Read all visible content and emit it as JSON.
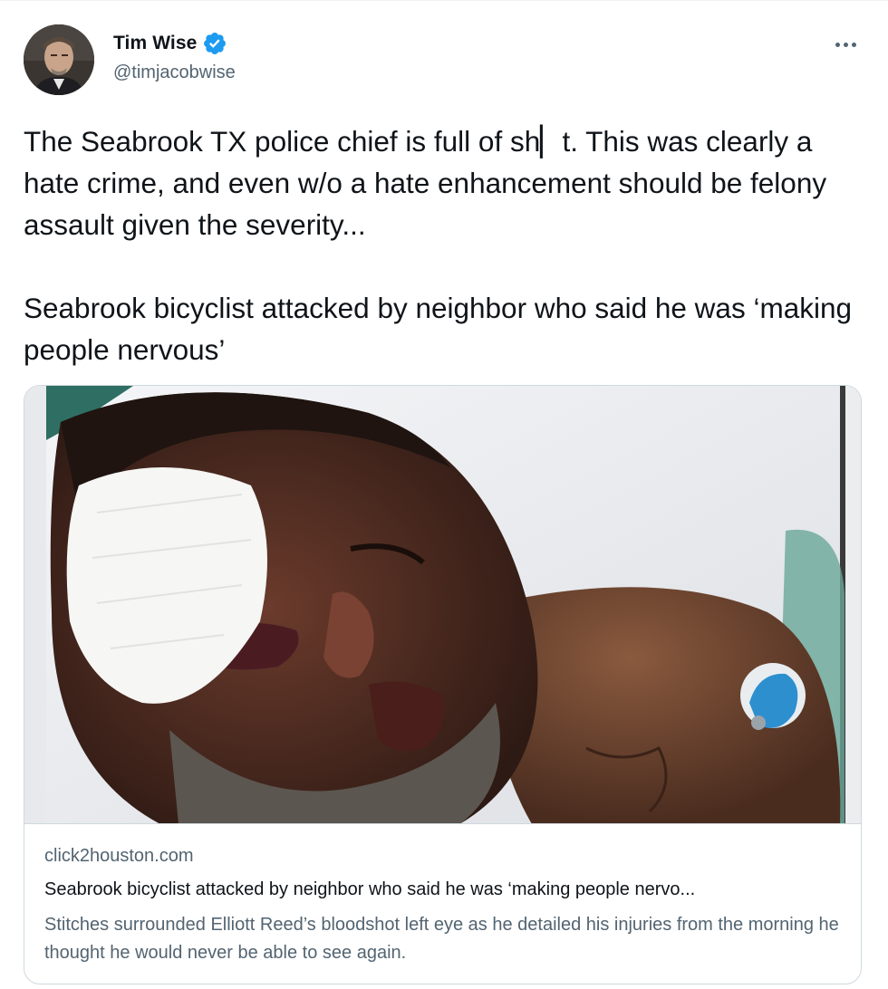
{
  "author": {
    "display_name": "Tim Wise",
    "handle": "@timjacobwise",
    "verified": true,
    "verified_color": "#1d9bf0"
  },
  "tweet": {
    "text_paragraph_1": "The Seabrook TX police chief is full of sh▏t. This was clearly a hate crime, and even w/o a hate enhancement should be felony assault given the severity...",
    "text_paragraph_2": "Seabrook bicyclist attacked by neighbor who said he was ‘making people nervous’"
  },
  "card": {
    "domain": "click2houston.com",
    "title": "Seabrook bicyclist attacked by neighbor who said he was ‘making people nervo...",
    "description": "Stitches surrounded Elliott Reed’s bloodshot left eye as he detailed his injuries from the morning he thought he would never be able to see again.",
    "image_subject": "injured-man-in-hospital-bed-photo"
  },
  "icons": {
    "verified": "verified-badge-icon",
    "more": "more-options-icon"
  },
  "colors": {
    "text_primary": "#0f1419",
    "text_secondary": "#536471",
    "border": "#cfd9de",
    "accent": "#1d9bf0"
  }
}
